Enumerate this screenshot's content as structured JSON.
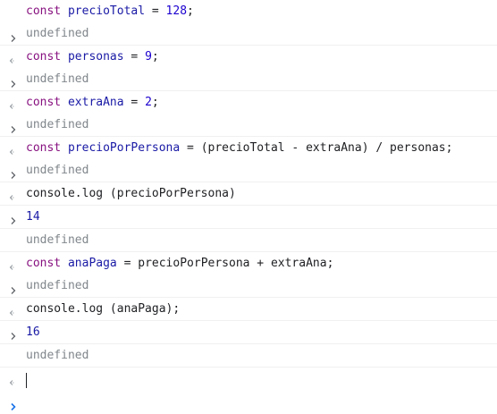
{
  "colors": {
    "keyword": "#881280",
    "variable": "#1a1aa6",
    "number": "#1c00cf",
    "undefined": "#80868b",
    "prompt_active": "#1a73e8",
    "gutter": "#5f6368"
  },
  "icons": {
    "input": "chevron-right-icon",
    "result": "return-arrow-icon",
    "prompt": "chevron-right-icon"
  },
  "entries": [
    {
      "input": {
        "kw": "const",
        "name": "precioTotal",
        "op": "=",
        "rest_num": "128",
        "end": ";"
      },
      "result": "undefined"
    },
    {
      "input": {
        "kw": "const",
        "name": "personas",
        "op": "=",
        "rest_num": "9",
        "end": ";"
      },
      "result": "undefined"
    },
    {
      "input": {
        "kw": "const",
        "name": "extraAna",
        "op": "=",
        "rest_num": "2",
        "end": ";"
      },
      "result": "undefined"
    },
    {
      "input": {
        "kw": "const",
        "name": "precioPorPersona",
        "op": "=",
        "expr": "(precioTotal - extraAna) / personas;"
      },
      "result": "undefined"
    },
    {
      "input_plain": "console.log (precioPorPersona)",
      "log": "14",
      "result": "undefined"
    },
    {
      "input": {
        "kw": "const",
        "name": "anaPaga",
        "op": "=",
        "expr": "precioPorPersona + extraAna;"
      },
      "result": "undefined"
    },
    {
      "input_plain": "console.log (anaPaga);",
      "log": "16",
      "result": "undefined"
    }
  ]
}
